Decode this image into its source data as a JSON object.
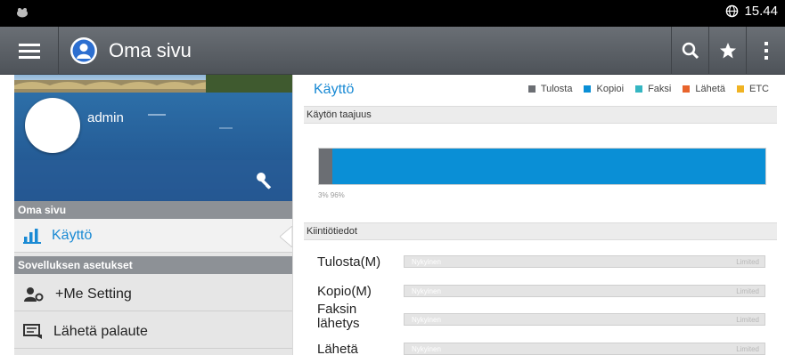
{
  "statusbar": {
    "time": "15.44"
  },
  "actionbar": {
    "title": "Oma sivu"
  },
  "user": {
    "name": "admin"
  },
  "sidebar": {
    "section1": "Oma sivu",
    "usage_item": "Käyttö",
    "section2": "Sovelluksen asetukset",
    "me_setting": "+Me Setting",
    "feedback": "Lähetä palaute"
  },
  "usage": {
    "title": "Käyttö",
    "legend": [
      {
        "label": "Tulosta",
        "color": "#6b6e73"
      },
      {
        "label": "Kopioi",
        "color": "#0a8fd6"
      },
      {
        "label": "Faksi",
        "color": "#35b6c2"
      },
      {
        "label": "Lähetä",
        "color": "#e8642c"
      },
      {
        "label": "ETC",
        "color": "#f0b323"
      }
    ],
    "frequency_header": "Käytön taajuus",
    "segments": [
      {
        "name": "Tulosta",
        "percent": 3,
        "color": "#6b6e73"
      },
      {
        "name": "Kopioi",
        "percent": 97,
        "color": "#0a8fd6"
      }
    ],
    "bar_labels": "3% 96%"
  },
  "quota": {
    "header": "Kiintiötiedot",
    "current_label": "Nykyinen",
    "limit_label": "Limited",
    "rows": [
      {
        "label": "Tulosta(M)"
      },
      {
        "label": "Kopio(M)"
      },
      {
        "label": "Faksin lähetys"
      },
      {
        "label": "Lähetä"
      }
    ]
  }
}
